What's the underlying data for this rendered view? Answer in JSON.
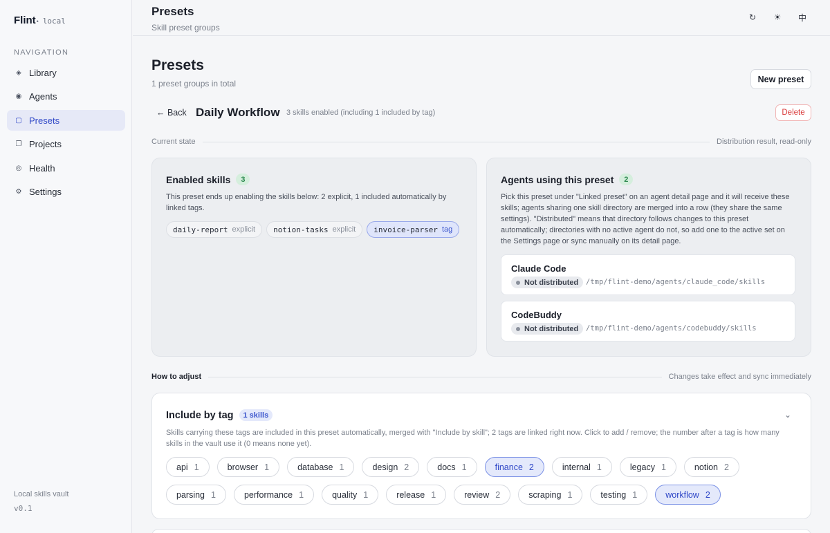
{
  "app": {
    "name": "Flint",
    "dot": "•",
    "env": "local"
  },
  "sidebar": {
    "heading": "NAVIGATION",
    "items": [
      {
        "label": "Library",
        "icon": "◈"
      },
      {
        "label": "Agents",
        "icon": "◉"
      },
      {
        "label": "Presets",
        "icon": "▢"
      },
      {
        "label": "Projects",
        "icon": "❐"
      },
      {
        "label": "Health",
        "icon": "◎"
      },
      {
        "label": "Settings",
        "icon": "⚙"
      }
    ],
    "active_index": 2,
    "footer_title": "Local skills vault",
    "footer_version": "v0.1"
  },
  "topbar": {
    "title": "Presets",
    "subtitle": "Skill preset groups",
    "icons": {
      "refresh": "↻",
      "theme": "☀",
      "language": "中"
    }
  },
  "page": {
    "title": "Presets",
    "subtitle": "1 preset groups in total",
    "new_button": "New preset"
  },
  "preset": {
    "back_label": "← Back",
    "name": "Daily Workflow",
    "meta": "3 skills enabled (including 1 included by tag)",
    "delete_label": "Delete"
  },
  "state_divider": {
    "left": "Current state",
    "right": "Distribution result, read-only"
  },
  "enabled": {
    "title": "Enabled skills",
    "count": "3",
    "description": "This preset ends up enabling the skills below: 2 explicit, 1 included automatically by linked tags.",
    "skills": [
      {
        "name": "daily-report",
        "kind": "explicit"
      },
      {
        "name": "notion-tasks",
        "kind": "explicit"
      },
      {
        "name": "invoice-parser",
        "kind": "tag"
      }
    ]
  },
  "agents": {
    "title": "Agents using this preset",
    "count": "2",
    "description": "Pick this preset under \"Linked preset\" on an agent detail page and it will receive these skills; agents sharing one skill directory are merged into a row (they share the same settings). \"Distributed\" means that directory follows changes to this preset automatically; directories with no active agent do not, so add one to the active set on the Settings page or sync manually on its detail page.",
    "list": [
      {
        "name": "Claude Code",
        "status": "Not distributed",
        "path": "/tmp/flint-demo/agents/claude_code/skills"
      },
      {
        "name": "CodeBuddy",
        "status": "Not distributed",
        "path": "/tmp/flint-demo/agents/codebuddy/skills"
      }
    ]
  },
  "adjust_divider": {
    "left": "How to adjust",
    "right": "Changes take effect and sync immediately"
  },
  "include_by_tag": {
    "title": "Include by tag",
    "badge": "1 skills",
    "chevron": "⌄",
    "description": "Skills carrying these tags are included in this preset automatically, merged with \"Include by skill\"; 2 tags are linked right now. Click to add / remove; the number after a tag is how many skills in the vault use it (0 means none yet).",
    "tags": [
      {
        "name": "api",
        "count": "1",
        "selected": false
      },
      {
        "name": "browser",
        "count": "1",
        "selected": false
      },
      {
        "name": "database",
        "count": "1",
        "selected": false
      },
      {
        "name": "design",
        "count": "2",
        "selected": false
      },
      {
        "name": "docs",
        "count": "1",
        "selected": false
      },
      {
        "name": "finance",
        "count": "2",
        "selected": true
      },
      {
        "name": "internal",
        "count": "1",
        "selected": false
      },
      {
        "name": "legacy",
        "count": "1",
        "selected": false
      },
      {
        "name": "notion",
        "count": "2",
        "selected": false
      },
      {
        "name": "parsing",
        "count": "1",
        "selected": false
      },
      {
        "name": "performance",
        "count": "1",
        "selected": false
      },
      {
        "name": "quality",
        "count": "1",
        "selected": false
      },
      {
        "name": "release",
        "count": "1",
        "selected": false
      },
      {
        "name": "review",
        "count": "2",
        "selected": false
      },
      {
        "name": "scraping",
        "count": "1",
        "selected": false
      },
      {
        "name": "testing",
        "count": "1",
        "selected": false
      },
      {
        "name": "workflow",
        "count": "2",
        "selected": true
      }
    ]
  },
  "colors": {
    "accent": "#2f47c7",
    "danger": "#d93a3a",
    "success": "#2e8a50"
  }
}
